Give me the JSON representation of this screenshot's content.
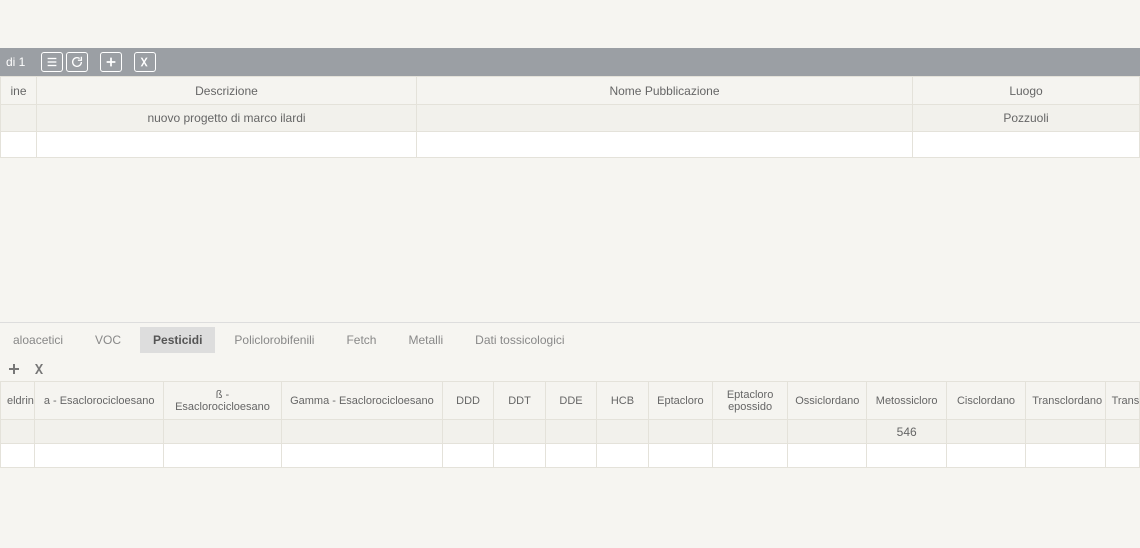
{
  "toolbar": {
    "label": "di 1"
  },
  "mainTable": {
    "headers": {
      "col1": "ine",
      "col2": "Descrizione",
      "col3": "Nome Pubblicazione",
      "col4": "Luogo"
    },
    "row": {
      "descrizione": "nuovo progetto di marco ilardi",
      "nome_pubblicazione": "",
      "luogo": "Pozzuoli"
    }
  },
  "tabs": [
    {
      "label": "aloacetici",
      "active": false
    },
    {
      "label": "VOC",
      "active": false
    },
    {
      "label": "Pesticidi",
      "active": true
    },
    {
      "label": "Policlorobifenili",
      "active": false
    },
    {
      "label": "Fetch",
      "active": false
    },
    {
      "label": "Metalli",
      "active": false
    },
    {
      "label": "Dati tossicologici",
      "active": false
    }
  ],
  "detailTable": {
    "headers": {
      "col1": "eldrin",
      "col2": "a - Esaclorocicloesano",
      "col3": "ß - Esaclorocicloesano",
      "col4": "Gamma - Esaclorocicloesano",
      "col5": "DDD",
      "col6": "DDT",
      "col7": "DDE",
      "col8": "HCB",
      "col9": "Eptacloro",
      "col10": "Eptacloro epossido",
      "col11": "Ossiclordano",
      "col12": "Metossicloro",
      "col13": "Cisclordano",
      "col14": "Transclordano",
      "col15": "Trans"
    },
    "row": {
      "metossicloro": "546"
    }
  }
}
